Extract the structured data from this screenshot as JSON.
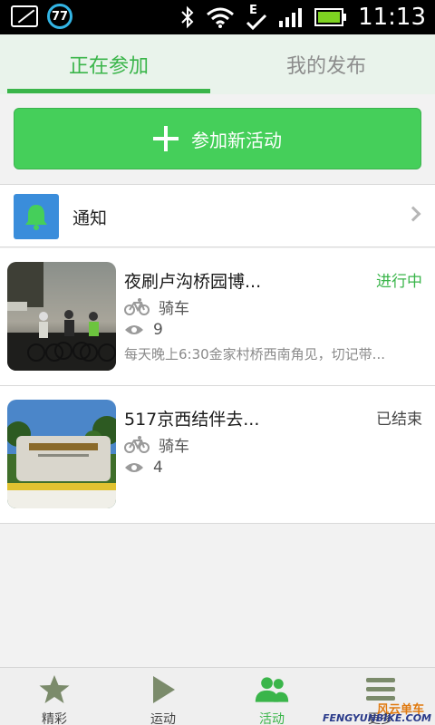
{
  "status_bar": {
    "notification_count": "77",
    "clock": "11:13",
    "network_type": "E"
  },
  "tabs": [
    {
      "label": "正在参加",
      "active": true
    },
    {
      "label": "我的发布",
      "active": false
    }
  ],
  "join_button": {
    "label": "参加新活动"
  },
  "notice": {
    "label": "通知"
  },
  "activities": [
    {
      "title": "夜刷卢沟桥园博...",
      "status": "进行中",
      "status_color": "#3ab54a",
      "type": "骑车",
      "views": "9",
      "description": "每天晚上6:30金家村桥西南角见，切记带...",
      "thumbnail": "night-cyclists-photo"
    },
    {
      "title": "517京西结伴去...",
      "status": "已结束",
      "status_color": "#444444",
      "type": "骑车",
      "views": "4",
      "description": "",
      "thumbnail": "park-entrance-photo"
    }
  ],
  "bottom_nav": [
    {
      "label": "精彩",
      "icon": "star-icon",
      "active": false
    },
    {
      "label": "运动",
      "icon": "play-icon",
      "active": false
    },
    {
      "label": "活动",
      "icon": "people-icon",
      "active": true
    },
    {
      "label": "更多",
      "icon": "menu-icon",
      "active": false
    }
  ],
  "watermark": {
    "text": "FENGYUNBIKE.COM",
    "cn": "风云单车"
  },
  "colors": {
    "accent": "#3ab54a",
    "button": "#45cf5a",
    "bell": "#3a8ddb"
  }
}
